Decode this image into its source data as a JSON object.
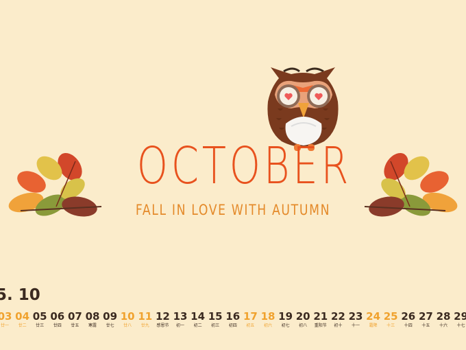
{
  "heading": {
    "title": "OCTOBER",
    "subtitle": "FALL IN LOVE WITH AUTUMN"
  },
  "colors": {
    "background": "#fbeccb",
    "title": "#e8521e",
    "subtitle": "#e48a2a",
    "calendar_text": "#3b2a20",
    "calendar_highlight": "#f0a22e"
  },
  "calendar": {
    "month_label": "5. 10",
    "days": [
      {
        "num": "03",
        "lunar": "廿一",
        "hl": true
      },
      {
        "num": "04",
        "lunar": "廿二",
        "hl": true
      },
      {
        "num": "05",
        "lunar": "廿三",
        "hl": false
      },
      {
        "num": "06",
        "lunar": "廿四",
        "hl": false
      },
      {
        "num": "07",
        "lunar": "廿五",
        "hl": false
      },
      {
        "num": "08",
        "lunar": "寒露",
        "hl": false
      },
      {
        "num": "09",
        "lunar": "廿七",
        "hl": false
      },
      {
        "num": "10",
        "lunar": "廿八",
        "hl": true
      },
      {
        "num": "11",
        "lunar": "廿九",
        "hl": true
      },
      {
        "num": "12",
        "lunar": "感恩节",
        "hl": false
      },
      {
        "num": "13",
        "lunar": "初一",
        "hl": false
      },
      {
        "num": "14",
        "lunar": "初二",
        "hl": false
      },
      {
        "num": "15",
        "lunar": "初三",
        "hl": false
      },
      {
        "num": "16",
        "lunar": "初四",
        "hl": false
      },
      {
        "num": "17",
        "lunar": "初五",
        "hl": true
      },
      {
        "num": "18",
        "lunar": "初六",
        "hl": true
      },
      {
        "num": "19",
        "lunar": "初七",
        "hl": false
      },
      {
        "num": "20",
        "lunar": "初八",
        "hl": false
      },
      {
        "num": "21",
        "lunar": "重阳节",
        "hl": false
      },
      {
        "num": "22",
        "lunar": "初十",
        "hl": false
      },
      {
        "num": "23",
        "lunar": "十一",
        "hl": false
      },
      {
        "num": "24",
        "lunar": "霜降",
        "hl": true
      },
      {
        "num": "25",
        "lunar": "十三",
        "hl": true
      },
      {
        "num": "26",
        "lunar": "十四",
        "hl": false
      },
      {
        "num": "27",
        "lunar": "十五",
        "hl": false
      },
      {
        "num": "28",
        "lunar": "十六",
        "hl": false
      },
      {
        "num": "29",
        "lunar": "十七",
        "hl": false
      }
    ]
  },
  "illustrations": {
    "owl": "owl-icon",
    "leaves_left": "leaf-cluster-icon",
    "leaves_right": "leaf-cluster-icon"
  }
}
